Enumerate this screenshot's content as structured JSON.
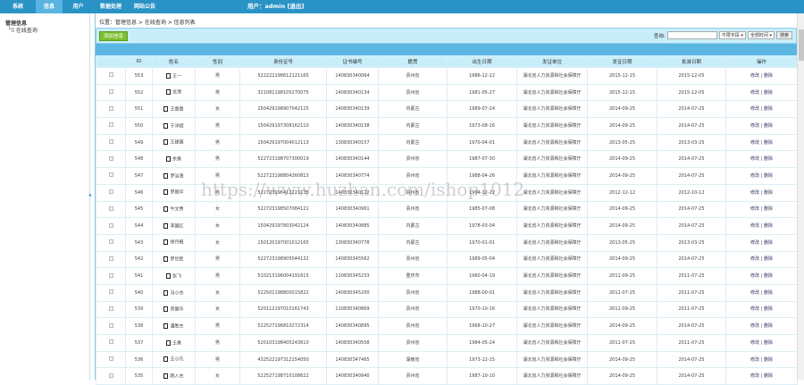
{
  "nav": [
    {
      "label": "系统"
    },
    {
      "label": "信息"
    },
    {
      "label": "用户"
    },
    {
      "label": "数据处理"
    },
    {
      "label": "网站公告"
    }
  ],
  "user": {
    "text": "用户：admin",
    "logout": "[退出]"
  },
  "sidebar": {
    "title": "管理信息",
    "item": "在线查询"
  },
  "breadcrumb": "位置：管理信息 > 在线查询 > 信息列表",
  "toolbar": {
    "add_label": "添加信息",
    "search_label": "查询:",
    "search_value": "",
    "field_select": "不限字段 ▾",
    "time_select": "全部时间 ▾",
    "search_button": "搜索"
  },
  "columns": [
    "",
    "ID",
    "姓名",
    "性别",
    "身份证号",
    "证书编号",
    "籍贯",
    "出生日期",
    "发证单位",
    "发证日期",
    "批准日期",
    "操作"
  ],
  "ops": {
    "edit": "修改",
    "sep": "|",
    "delete": "删除"
  },
  "rows": [
    {
      "id": "553",
      "name": "王一",
      "sex": "男",
      "idcard": "522222198612121165",
      "cert": "140830340064",
      "origin": "贵州省",
      "birth": "1986-12-12",
      "issuer": "湖北省人力资源和社会保障厅",
      "issue": "2015-12-15",
      "approve": "2015-12-05"
    },
    {
      "id": "552",
      "name": "龙潭",
      "sex": "男",
      "idcard": "321081198105270075",
      "cert": "140830340134",
      "origin": "贵州省",
      "birth": "1981-05-27",
      "issuer": "湖北省人力资源和社会保障厅",
      "issue": "2015-12-15",
      "approve": "2015-12-05"
    },
    {
      "id": "551",
      "name": "王蕾蕾",
      "sex": "女",
      "idcard": "150429198907042125",
      "cert": "140830340139",
      "origin": "内蒙古",
      "birth": "1989-07-24",
      "issuer": "湖北省人力资源和社会保障厅",
      "issue": "2014-09-25",
      "approve": "2014-07-25"
    },
    {
      "id": "550",
      "name": "于洋斌",
      "sex": "男",
      "idcard": "150429197308162110",
      "cert": "140830340138",
      "origin": "内蒙古",
      "birth": "1973-08-16",
      "issuer": "湖北省人力资源和社会保障厅",
      "issue": "2014-09-25",
      "approve": "2014-07-25"
    },
    {
      "id": "549",
      "name": "王建国",
      "sex": "男",
      "idcard": "150429197004012113",
      "cert": "130830340157",
      "origin": "内蒙古",
      "birth": "1970-04-01",
      "issuer": "湖北省人力资源和社会保障厅",
      "issue": "2013-05-25",
      "approve": "2013-03-25"
    },
    {
      "id": "548",
      "name": "余勇",
      "sex": "男",
      "idcard": "522723198707300019",
      "cert": "140830340144",
      "origin": "贵州省",
      "birth": "1987-07-30",
      "issuer": "湖北省人力资源和社会保障厅",
      "issue": "2014-09-25",
      "approve": "2014-07-25"
    },
    {
      "id": "547",
      "name": "罗治海",
      "sex": "男",
      "idcard": "522723198804260813",
      "cert": "140830340774",
      "origin": "贵州省",
      "birth": "1988-04-26",
      "issuer": "湖北省人力资源和社会保障厅",
      "issue": "2014-09-25",
      "approve": "2014-07-25"
    },
    {
      "id": "546",
      "name": "罗振华",
      "sex": "男",
      "idcard": "522723196412221135",
      "cert": "140830340122",
      "origin": "贵州省",
      "birth": "1964-12-22",
      "issuer": "湖北省人力资源和社会保障厅",
      "issue": "2012-12-12",
      "approve": "2012-10-12"
    },
    {
      "id": "545",
      "name": "牛文秀",
      "sex": "女",
      "idcard": "522723198507084121",
      "cert": "140830340961",
      "origin": "贵州省",
      "birth": "1985-07-08",
      "issuer": "湖北省人力资源和社会保障厅",
      "issue": "2014-09-25",
      "approve": "2014-07-25"
    },
    {
      "id": "544",
      "name": "李国红",
      "sex": "女",
      "idcard": "150429197803042124",
      "cert": "140830340885",
      "origin": "内蒙古",
      "birth": "1978-03-04",
      "issuer": "湖北省人力资源和社会保障厅",
      "issue": "2014-09-25",
      "approve": "2014-07-25"
    },
    {
      "id": "543",
      "name": "徐丹梅",
      "sex": "女",
      "idcard": "150120197001012165",
      "cert": "130830340778",
      "origin": "内蒙古",
      "birth": "1970-01-01",
      "issuer": "湖北省人力资源和社会保障厅",
      "issue": "2013-05-25",
      "approve": "2013-03-25"
    },
    {
      "id": "542",
      "name": "罗世民",
      "sex": "男",
      "idcard": "522723198905044132",
      "cert": "140830345562",
      "origin": "贵州省",
      "birth": "1989-05-04",
      "issuer": "湖北省人力资源和社会保障厅",
      "issue": "2014-09-25",
      "approve": "2014-07-25"
    },
    {
      "id": "541",
      "name": "张飞",
      "sex": "男",
      "idcard": "510213196004191615",
      "cert": "110830345233",
      "origin": "重庆市",
      "birth": "1960-04-19",
      "issuer": "湖北省人力资源和社会保障厅",
      "issue": "2011-09-25",
      "approve": "2011-07-25"
    },
    {
      "id": "540",
      "name": "冯小杰",
      "sex": "女",
      "idcard": "522501198800015822",
      "cert": "140830345200",
      "origin": "贵州省",
      "birth": "1988-00-01",
      "issuer": "湖北省人力资源和社会保障厅",
      "issue": "2011-07-25",
      "approve": "2011-07-25"
    },
    {
      "id": "539",
      "name": "曾健华",
      "sex": "女",
      "idcard": "520112197010161743",
      "cert": "110830340869",
      "origin": "贵州省",
      "birth": "1970-10-16",
      "issuer": "湖北省人力资源和社会保障厅",
      "issue": "2011-09-25",
      "approve": "2011-07-25"
    },
    {
      "id": "538",
      "name": "潘胜杰",
      "sex": "男",
      "idcard": "522527196810272314",
      "cert": "140830340895",
      "origin": "贵州省",
      "birth": "1968-10-27",
      "issuer": "湖北省人力资源和社会保障厅",
      "issue": "2014-09-25",
      "approve": "2014-07-25"
    },
    {
      "id": "537",
      "name": "王勇",
      "sex": "男",
      "idcard": "520103198405243610",
      "cert": "140830340558",
      "origin": "贵州省",
      "birth": "1984-05-24",
      "issuer": "湖北省人力资源和社会保障厅",
      "issue": "2011-07-25",
      "approve": "2011-07-25"
    },
    {
      "id": "536",
      "name": "王小凡",
      "sex": "男",
      "idcard": "432522197312154050",
      "cert": "140830347465",
      "origin": "湖南省",
      "birth": "1973-12-15",
      "issuer": "湖北省人力资源和社会保障厅",
      "issue": "2014-09-25",
      "approve": "2014-07-25"
    },
    {
      "id": "535",
      "name": "韩人杰",
      "sex": "女",
      "idcard": "522527198710108622",
      "cert": "140830340940",
      "origin": "贵州省",
      "birth": "1987-10-10",
      "issuer": "湖北省人力资源和社会保障厅",
      "issue": "2014-09-25",
      "approve": "2014-07-25"
    }
  ],
  "watermark": "https://www.huzhan.com/ishop1012",
  "colors": {
    "topbar": "#2a93c6",
    "accent": "#7cbf2f",
    "band": "#5bb6e2",
    "header": "#c8eefa"
  }
}
